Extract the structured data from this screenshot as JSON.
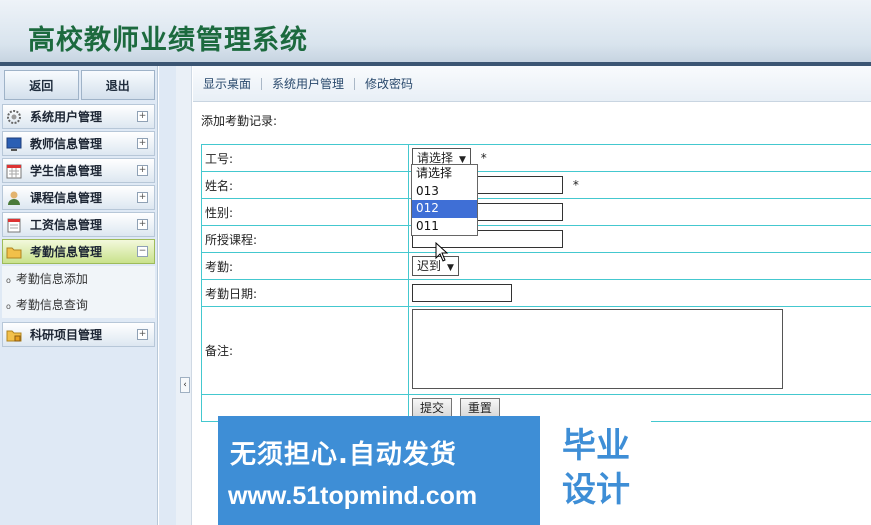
{
  "header": {
    "title": "高校教师业绩管理系统"
  },
  "sidebar": {
    "back_label": "返回",
    "logout_label": "退出",
    "items": [
      {
        "label": "系统用户管理",
        "icon": "gear-icon",
        "toggle": "+"
      },
      {
        "label": "教师信息管理",
        "icon": "monitor-icon",
        "toggle": "+"
      },
      {
        "label": "学生信息管理",
        "icon": "calendar-icon",
        "toggle": "+"
      },
      {
        "label": "课程信息管理",
        "icon": "user-icon",
        "toggle": "+"
      },
      {
        "label": "工资信息管理",
        "icon": "calendar-icon",
        "toggle": "+"
      },
      {
        "label": "考勤信息管理",
        "icon": "folder-icon",
        "toggle": "−"
      },
      {
        "label": "科研项目管理",
        "icon": "folder-lock-icon",
        "toggle": "+"
      }
    ],
    "submenu": [
      "考勤信息添加",
      "考勤信息查询"
    ],
    "collapse_icon": "‹"
  },
  "nav": {
    "links": [
      "显示桌面",
      "系统用户管理",
      "修改密码"
    ]
  },
  "form": {
    "section_title": "添加考勤记录:",
    "labels": {
      "gonghao": "工号:",
      "name": "姓名:",
      "gender": "性别:",
      "course": "所授课程:",
      "attendance": "考勤:",
      "date": "考勤日期:",
      "remark": "备注:"
    },
    "gonghao_selected": "请选择",
    "attendance_selected": "迟到",
    "required_mark": "*",
    "submit_label": "提交",
    "reset_label": "重置",
    "dropdown_options": [
      "请选择",
      "013",
      "012",
      "011"
    ],
    "dropdown_highlighted": "012"
  },
  "banner": {
    "main_text": "无须担心.自动发货",
    "url_text": "www.51topmind.com",
    "side_line1": "毕业",
    "side_line2": "设计"
  }
}
